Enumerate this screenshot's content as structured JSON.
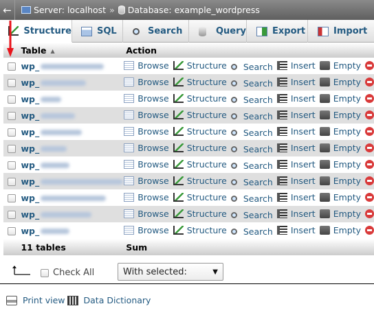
{
  "breadcrumb": {
    "back_icon": "back-arrow-icon",
    "server": "Server: localhost",
    "separator": "»",
    "database": "Database: example_wordpress"
  },
  "tabs": [
    {
      "label": "Structure",
      "icon": "structure-icon",
      "active": true
    },
    {
      "label": "SQL",
      "icon": "sql-icon"
    },
    {
      "label": "Search",
      "icon": "search-icon"
    },
    {
      "label": "Query",
      "icon": "query-icon"
    },
    {
      "label": "Export",
      "icon": "export-icon"
    },
    {
      "label": "Import",
      "icon": "import-icon"
    }
  ],
  "table": {
    "headers": {
      "name": "Table",
      "action": "Action"
    },
    "actions": {
      "browse": "Browse",
      "structure": "Structure",
      "search": "Search",
      "insert": "Insert",
      "empty": "Empty"
    },
    "rows": [
      {
        "name": "wp_"
      },
      {
        "name": "wp_"
      },
      {
        "name": "wp_"
      },
      {
        "name": "wp_"
      },
      {
        "name": "wp_"
      },
      {
        "name": "wp_"
      },
      {
        "name": "wp_"
      },
      {
        "name": "wp_"
      },
      {
        "name": "wp_"
      },
      {
        "name": "wp_"
      },
      {
        "name": "wp_"
      }
    ],
    "footer": {
      "count": "11 tables",
      "sum": "Sum"
    }
  },
  "bottom": {
    "check_all": "Check All",
    "with_selected": "With selected:"
  },
  "links": {
    "print_view": "Print view",
    "data_dictionary": "Data Dictionary"
  },
  "colors": {
    "link": "#235a81",
    "row_alt": "#dfdfdf",
    "annotation_arrow": "#e8141b"
  }
}
